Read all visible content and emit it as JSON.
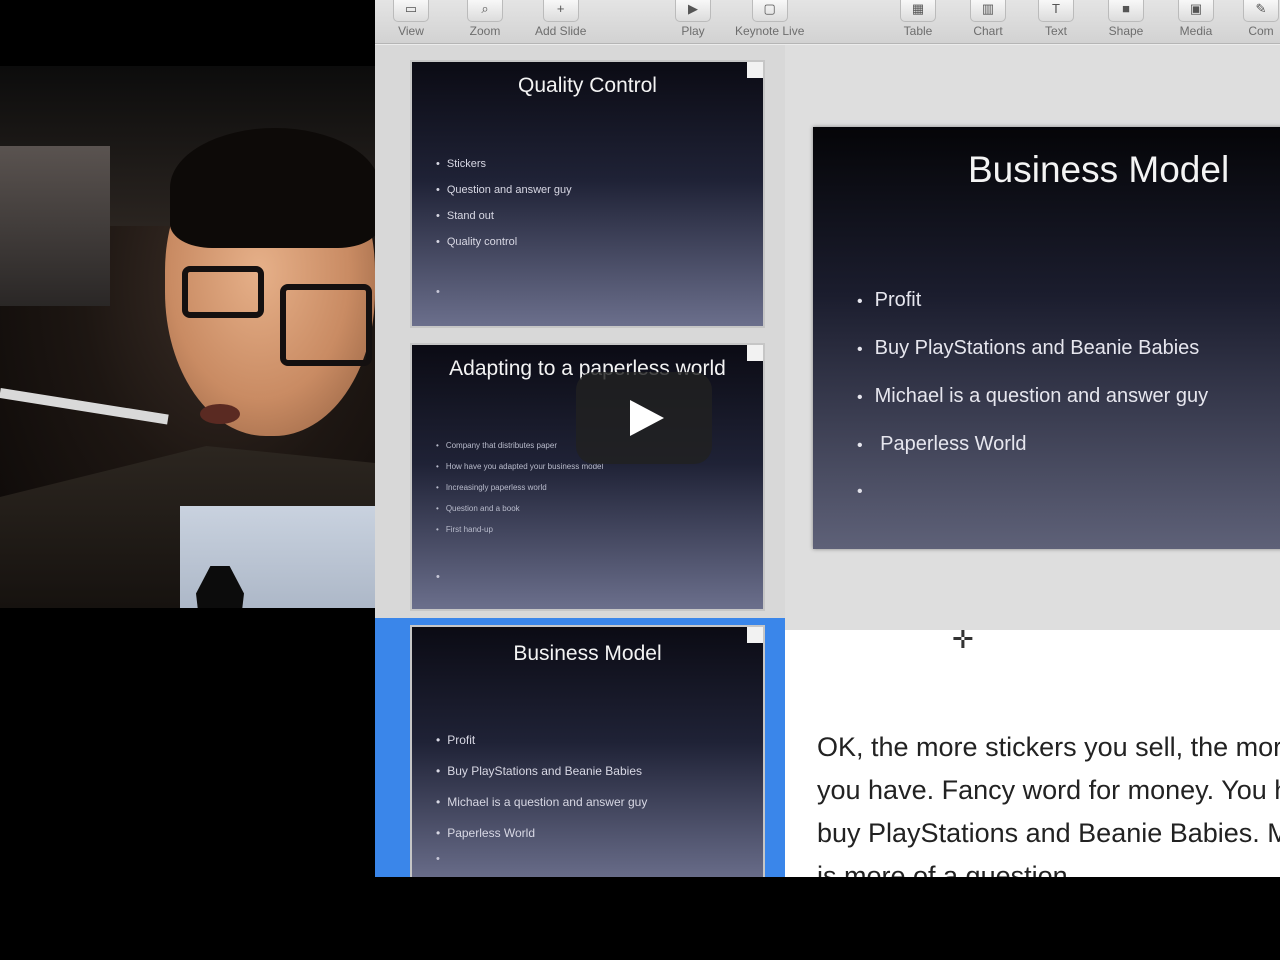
{
  "toolbar": {
    "items": [
      {
        "label": "View",
        "icon": "view-icon"
      },
      {
        "label": "Zoom",
        "icon": "zoom-icon"
      },
      {
        "label": "Add Slide",
        "icon": "add-slide-icon"
      },
      {
        "label": "Play",
        "icon": "play-icon"
      },
      {
        "label": "Keynote Live",
        "icon": "keynote-live-icon"
      },
      {
        "label": "Table",
        "icon": "table-icon"
      },
      {
        "label": "Chart",
        "icon": "chart-icon"
      },
      {
        "label": "Text",
        "icon": "text-icon"
      },
      {
        "label": "Shape",
        "icon": "shape-icon"
      },
      {
        "label": "Media",
        "icon": "media-icon"
      },
      {
        "label": "Com",
        "icon": "comment-icon"
      }
    ]
  },
  "navigator": {
    "slides": [
      {
        "title": "Quality Control",
        "bullets": [
          "Stickers",
          "Question and answer guy",
          "Stand out",
          "Quality control"
        ]
      },
      {
        "title": "Adapting to a paperless world",
        "bullets": [
          "Company that distributes paper",
          "How have you adapted your business model",
          "Increasingly paperless world",
          "Question and a book",
          "First hand-up"
        ]
      },
      {
        "title": "Business Model",
        "bullets": [
          "Profit",
          "Buy PlayStations and Beanie Babies",
          "Michael is a question and answer guy",
          "Paperless World"
        ],
        "selected": true
      }
    ]
  },
  "main_slide": {
    "title": "Business Model",
    "bullets": [
      "Profit",
      "Buy PlayStations and Beanie Babies",
      "Michael is a question and answer guy",
      " Paperless World"
    ]
  },
  "notes": {
    "text": "OK, the more stickers you sell, the more profit you have. Fancy word for money. You have to buy PlayStations and Beanie Babies. Michael is more of a question"
  },
  "video": {
    "play_button": "play-icon"
  }
}
